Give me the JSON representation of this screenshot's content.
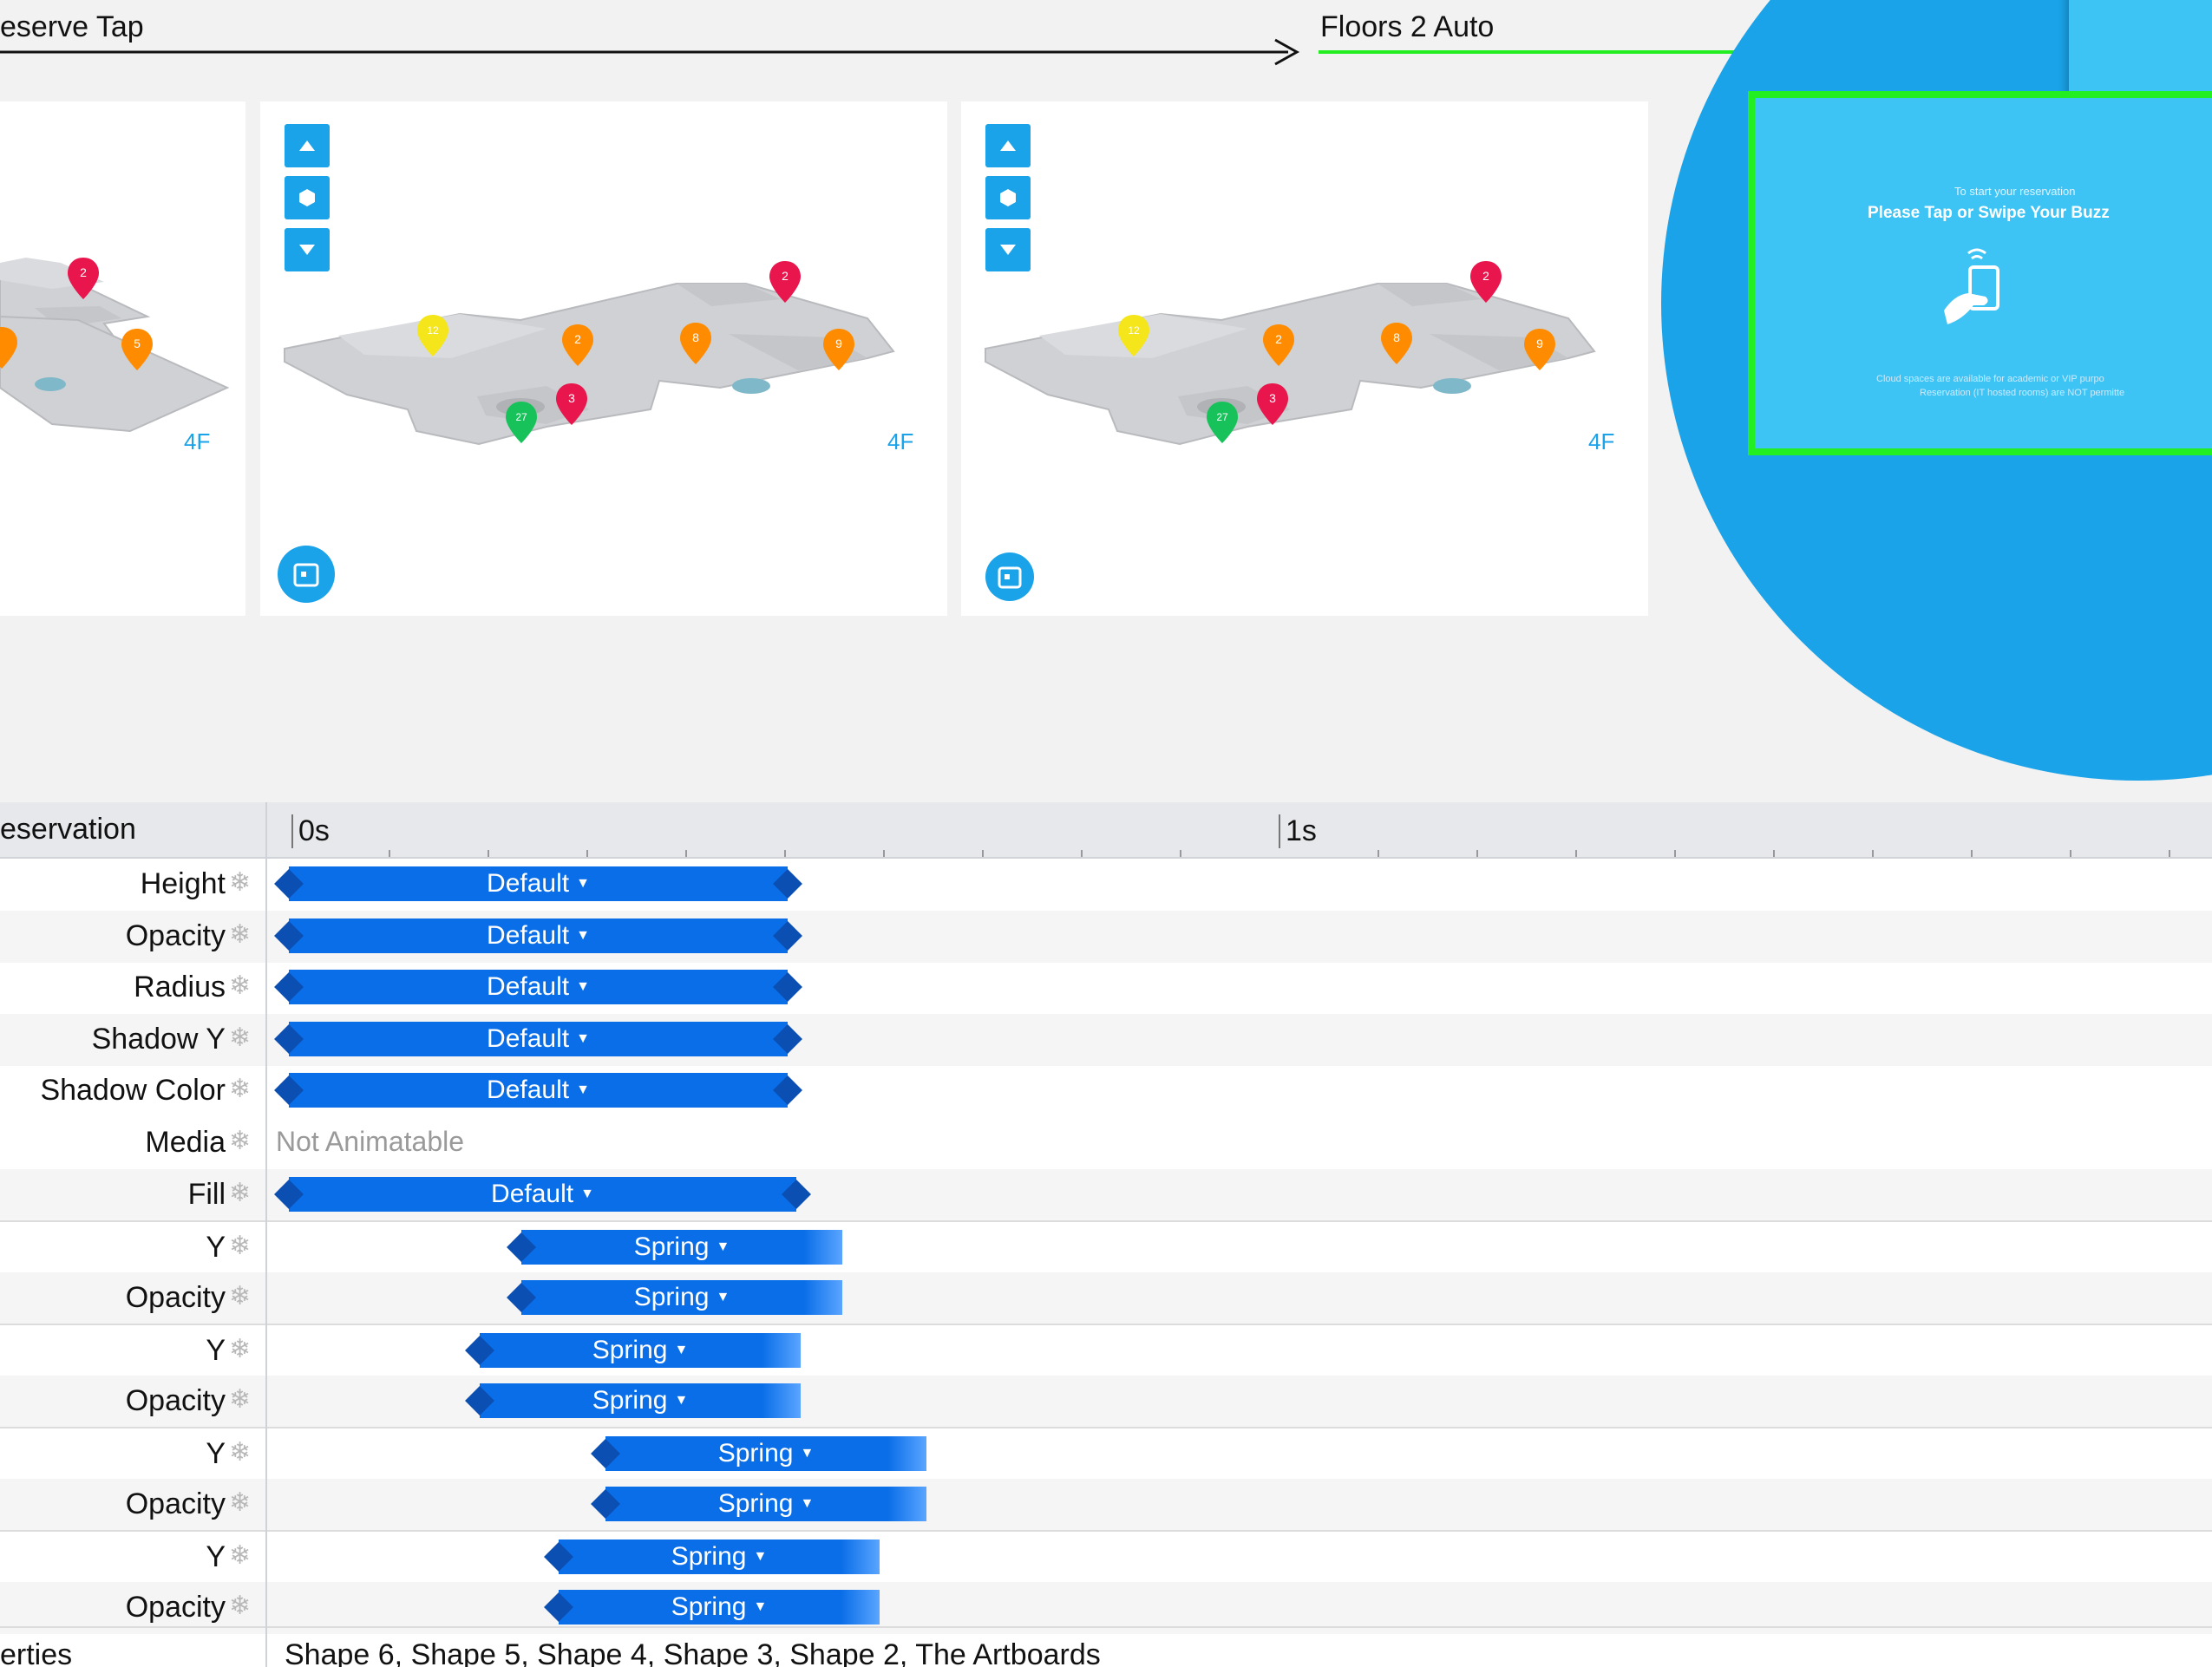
{
  "canvas": {
    "flow_left_label": "eserve Tap",
    "flow_right_label": "Floors 2 Auto",
    "floor_tag": "4F",
    "accent_color": "#1aa3e8",
    "highlight_color": "#22ee22",
    "popup": {
      "subtitle": "To start your reservation",
      "title": "Please Tap or Swipe Your Buzz",
      "note_line1": "Cloud spaces are available for academic or VIP purpo",
      "note_line2": "Reservation (IT hosted rooms) are NOT permitte"
    },
    "pin_labels": {
      "red_2": "2",
      "red_3": "3",
      "orange_2": "2",
      "orange_8": "8",
      "orange_9": "9",
      "orange_5": "5",
      "yellow_12": "12",
      "green_27": "27"
    }
  },
  "timeline": {
    "component_name": "eservation",
    "tick_0": "0s",
    "tick_1": "1s",
    "not_animatable": "Not Animatable",
    "rows": [
      {
        "property": "Height",
        "curve": "Default"
      },
      {
        "property": "Opacity",
        "curve": "Default"
      },
      {
        "property": "Radius",
        "curve": "Default"
      },
      {
        "property": "Shadow Y",
        "curve": "Default"
      },
      {
        "property": "Shadow Color",
        "curve": "Default"
      },
      {
        "property": "Media",
        "curve": ""
      },
      {
        "property": "Fill",
        "curve": "Default"
      },
      {
        "property": "Y",
        "curve": "Spring"
      },
      {
        "property": "Opacity",
        "curve": "Spring"
      },
      {
        "property": "Y",
        "curve": "Spring"
      },
      {
        "property": "Opacity",
        "curve": "Spring"
      },
      {
        "property": "Y",
        "curve": "Spring"
      },
      {
        "property": "Opacity",
        "curve": "Spring"
      },
      {
        "property": "Y",
        "curve": "Spring"
      },
      {
        "property": "Opacity",
        "curve": "Spring"
      }
    ],
    "footer_name": "erties",
    "footer_value": "Shape 6, Shape 5, Shape 4, Shape 3, Shape 2, The Artboards",
    "bar_color": "#0a6ee8"
  }
}
